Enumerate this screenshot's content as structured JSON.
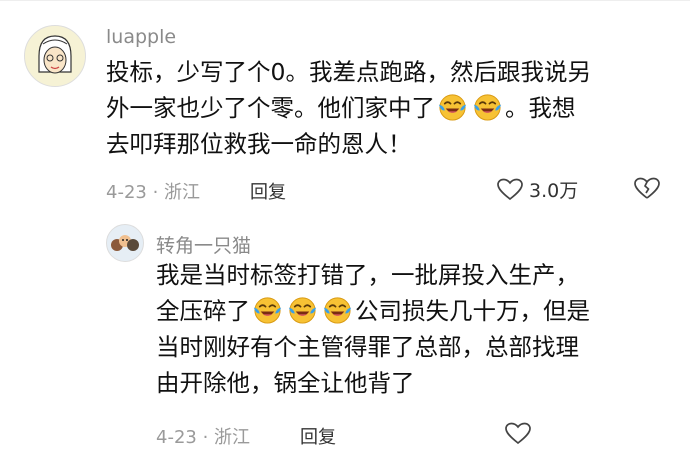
{
  "comment": {
    "author": "luapple",
    "text_line1_a": "投标，少写了个0。我差点跑路，然后跟我说另",
    "text_line2_a": "外一家也少了个零。他们家中了",
    "text_line2_b": "。我想",
    "text_line3": "去叩拜那位救我一命的恩人！",
    "date_location": "4-23 · 浙江",
    "reply_label": "回复",
    "like_count": "3.0万",
    "icons": {
      "like": "heart-icon",
      "dislike": "broken-heart-icon",
      "emoji": "laughing-crying-emoji"
    }
  },
  "reply": {
    "author": "转角一只猫",
    "text_line1": "我是当时标签打错了，一批屏投入生产，",
    "text_line2_a": "全压碎了",
    "text_line2_b": "公司损失几十万，但是",
    "text_line3": "当时刚好有个主管得罪了总部，总部找理",
    "text_line4": "由开除他，锅全让他背了",
    "date_location": "4-23 · 浙江",
    "reply_label": "回复"
  },
  "colors": {
    "meta": "#9a9a9a",
    "author": "#8a8a8a",
    "text": "#111111",
    "emoji_face": "#f7c234",
    "tears": "#3aa0e8"
  }
}
